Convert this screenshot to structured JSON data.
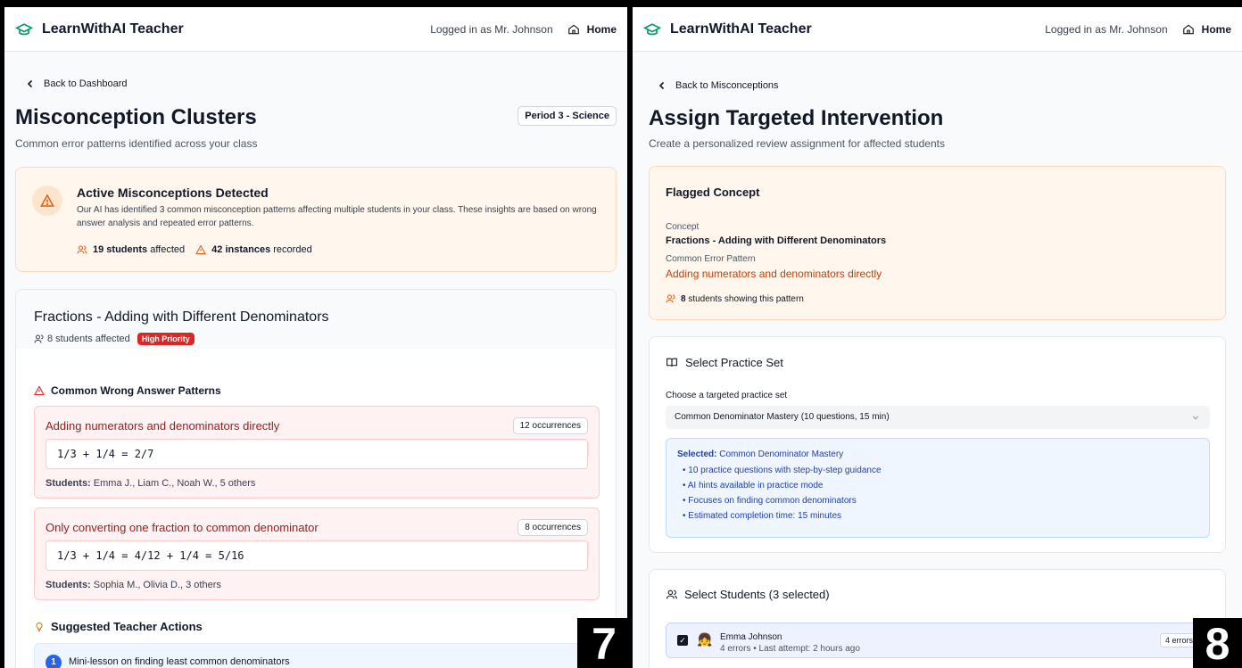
{
  "left": {
    "brand": "LearnWithAI Teacher",
    "logged_in": "Logged in as Mr. Johnson",
    "home": "Home",
    "back": "Back to Dashboard",
    "title": "Misconception Clusters",
    "subtitle": "Common error patterns identified across your class",
    "period": "Period 3 - Science",
    "alert": {
      "title": "Active Misconceptions Detected",
      "body": "Our AI has identified 3 common misconception patterns affecting multiple students in your class. These insights are based on wrong answer analysis and repeated error patterns.",
      "students_count": "19 students",
      "students_suffix": "affected",
      "instances_count": "42 instances",
      "instances_suffix": "recorded"
    },
    "cluster": {
      "title": "Fractions - Adding with Different Denominators",
      "affected": "8 students affected",
      "priority": "High Priority",
      "patterns_heading": "Common Wrong Answer Patterns",
      "patterns": [
        {
          "title": "Adding numerators and denominators directly",
          "occurrences": "12 occurrences",
          "example": "1/3 + 1/4 = 2/7",
          "students_label": "Students:",
          "students": "Emma J., Liam C., Noah W., 5 others"
        },
        {
          "title": "Only converting one fraction to common denominator",
          "occurrences": "8 occurrences",
          "example": "1/3 + 1/4 = 4/12 + 1/4 = 5/16",
          "students_label": "Students:",
          "students": "Sophia M., Olivia D., 3 others"
        }
      ],
      "actions_heading": "Suggested Teacher Actions",
      "actions": [
        {
          "num": "1",
          "text": "Mini-lesson on finding least common denominators"
        }
      ]
    },
    "tag": "7"
  },
  "right": {
    "brand": "LearnWithAI Teacher",
    "logged_in": "Logged in as Mr. Johnson",
    "home": "Home",
    "back": "Back to Misconceptions",
    "title": "Assign Targeted Intervention",
    "subtitle": "Create a personalized review assignment for affected students",
    "flagged": {
      "heading": "Flagged Concept",
      "concept_label": "Concept",
      "concept": "Fractions - Adding with Different Denominators",
      "error_label": "Common Error Pattern",
      "error": "Adding numerators and denominators directly",
      "count": "8",
      "count_suffix": "students showing this pattern"
    },
    "practice": {
      "heading": "Select Practice Set",
      "choose_label": "Choose a targeted practice set",
      "selected_option": "Common Denominator Mastery (10 questions, 15 min)",
      "selected_prefix": "Selected:",
      "selected_name": "Common Denominator Mastery",
      "bullets": [
        "• 10 practice questions with step-by-step guidance",
        "• AI hints available in practice mode",
        "• Focuses on finding common denominators",
        "• Estimated completion time: 15 minutes"
      ]
    },
    "students": {
      "heading": "Select Students (3 selected)",
      "items": [
        {
          "name": "Emma Johnson",
          "meta": "4 errors • Last attempt: 2 hours ago",
          "badge": "4 errors"
        }
      ]
    },
    "tag": "8"
  },
  "colors": {
    "accent": "#059669",
    "alert_bg": "#fff7ed",
    "warning": "#ea580c",
    "error_text": "#991b1b",
    "priority": "#dc2626"
  }
}
